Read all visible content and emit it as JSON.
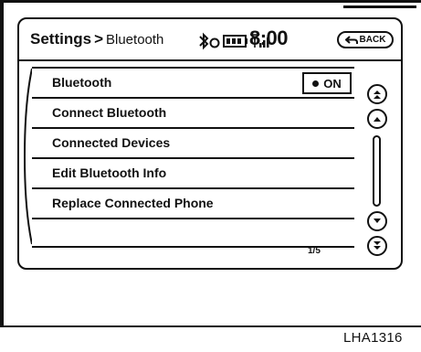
{
  "header": {
    "title": "Settings",
    "separator": ">",
    "subtitle": "Bluetooth",
    "clock": "8:00",
    "back_label": "BACK"
  },
  "status_icons": [
    "bluetooth-icon",
    "battery-icon",
    "signal-icon"
  ],
  "list": {
    "items": [
      {
        "label": "Bluetooth",
        "toggle": "ON"
      },
      {
        "label": "Connect Bluetooth"
      },
      {
        "label": "Connected Devices"
      },
      {
        "label": "Edit Bluetooth Info"
      },
      {
        "label": "Replace Connected Phone"
      },
      {
        "label": ""
      }
    ],
    "page_indicator": "1/5"
  },
  "scroll": {
    "icons": [
      "double-chevron-up-icon",
      "chevron-up-icon",
      "chevron-down-icon",
      "double-chevron-down-icon"
    ]
  },
  "figure_id": "LHA1316"
}
